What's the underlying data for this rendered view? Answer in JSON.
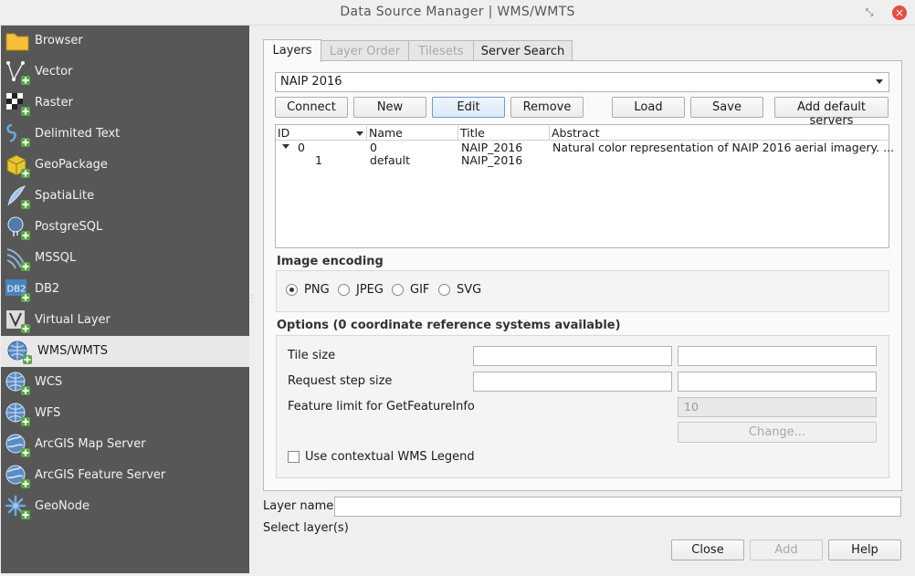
{
  "window": {
    "title": "Data Source Manager | WMS/WMTS",
    "restore_glyph": "⤡",
    "close_glyph": "×"
  },
  "sidebar": {
    "items": [
      {
        "label": "Browser",
        "icon": "folder-icon"
      },
      {
        "label": "Vector",
        "icon": "vector-icon"
      },
      {
        "label": "Raster",
        "icon": "raster-icon"
      },
      {
        "label": "Delimited Text",
        "icon": "delimited-text-icon"
      },
      {
        "label": "GeoPackage",
        "icon": "geopackage-icon"
      },
      {
        "label": "SpatiaLite",
        "icon": "spatialite-icon"
      },
      {
        "label": "PostgreSQL",
        "icon": "postgresql-icon"
      },
      {
        "label": "MSSQL",
        "icon": "mssql-icon"
      },
      {
        "label": "DB2",
        "icon": "db2-icon"
      },
      {
        "label": "Virtual Layer",
        "icon": "virtual-layer-icon"
      },
      {
        "label": "WMS/WMTS",
        "icon": "wms-icon",
        "selected": true
      },
      {
        "label": "WCS",
        "icon": "wcs-icon"
      },
      {
        "label": "WFS",
        "icon": "wfs-icon"
      },
      {
        "label": "ArcGIS Map Server",
        "icon": "arcgis-map-server-icon"
      },
      {
        "label": "ArcGIS Feature Server",
        "icon": "arcgis-feature-server-icon"
      },
      {
        "label": "GeoNode",
        "icon": "geonode-icon"
      }
    ],
    "db2_text": "DB2"
  },
  "tabs": [
    {
      "label": "Layers",
      "active": true
    },
    {
      "label": "Layer Order",
      "disabled": true
    },
    {
      "label": "Tilesets",
      "disabled": true
    },
    {
      "label": "Server Search"
    }
  ],
  "connection": {
    "selected": "NAIP 2016"
  },
  "buttons": {
    "connect": "Connect",
    "new": "New",
    "edit": "Edit",
    "remove": "Remove",
    "load": "Load",
    "save": "Save",
    "add_default": "Add default servers"
  },
  "layers_table": {
    "headers": [
      "ID",
      "Name",
      "Title",
      "Abstract"
    ],
    "rows": [
      {
        "id": "0",
        "name": "0",
        "title": "NAIP_2016",
        "abstract": "Natural color representation of NAIP 2016 aerial imagery. ..."
      },
      {
        "id": "1",
        "name": "default",
        "title": "NAIP_2016",
        "abstract": ""
      }
    ]
  },
  "image_encoding": {
    "label": "Image encoding",
    "options": [
      "PNG",
      "JPEG",
      "GIF",
      "SVG"
    ],
    "selected": "PNG"
  },
  "options": {
    "label": "Options (0 coordinate reference systems available)",
    "tile_size_label": "Tile size",
    "request_step_label": "Request step size",
    "feature_limit_label": "Feature limit for GetFeatureInfo",
    "feature_limit_value": "10",
    "change_label": "Change...",
    "contextual_legend_label": "Use contextual WMS Legend"
  },
  "layer_name": {
    "label": "Layer name",
    "value": ""
  },
  "status": {
    "text": "Select layer(s)"
  },
  "dialog_buttons": {
    "close": "Close",
    "add": "Add",
    "help": "Help"
  }
}
